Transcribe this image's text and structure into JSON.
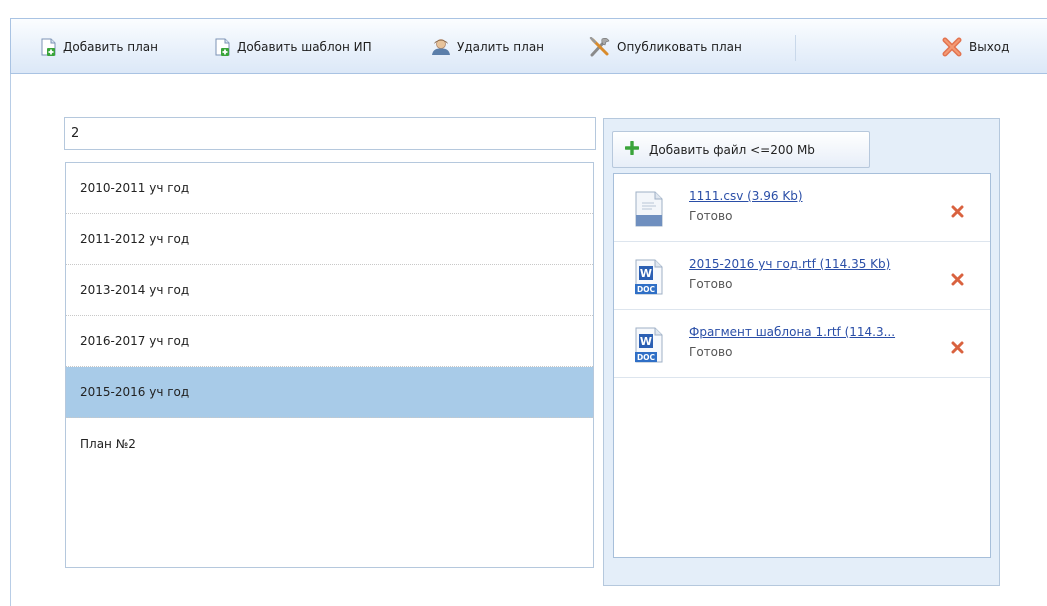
{
  "toolbar": {
    "add_plan": "Добавить план",
    "add_template": "Добавить шаблон ИП",
    "delete_plan": "Удалить план",
    "publish_plan": "Опубликовать план",
    "exit": "Выход"
  },
  "search": {
    "value": "2"
  },
  "plans": [
    {
      "label": "2010-2011 уч год",
      "selected": false
    },
    {
      "label": "2011-2012 уч год",
      "selected": false
    },
    {
      "label": "2013-2014 уч год",
      "selected": false
    },
    {
      "label": "2016-2017 уч год",
      "selected": false
    },
    {
      "label": "2015-2016 уч год",
      "selected": true
    },
    {
      "label": "План №2",
      "selected": false
    }
  ],
  "files_panel": {
    "add_file_label": "Добавить файл <=200 Mb",
    "files": [
      {
        "name": "1111.csv (3.96 Kb)",
        "status": "Готово",
        "icon": "csv-file-icon"
      },
      {
        "name": "2015-2016 уч год.rtf (114.35 Kb)",
        "status": "Готово",
        "icon": "word-doc-icon",
        "icon_text": "DOC"
      },
      {
        "name": "Фрагмент шаблона 1.rtf (114.3...",
        "status": "Готово",
        "icon": "word-doc-icon",
        "icon_text": "DOC"
      }
    ]
  },
  "colors": {
    "selected_row": "#a8cbe8",
    "link": "#2a4ea7",
    "delete_x": "#d9623f",
    "add_green": "#3aa43a"
  }
}
